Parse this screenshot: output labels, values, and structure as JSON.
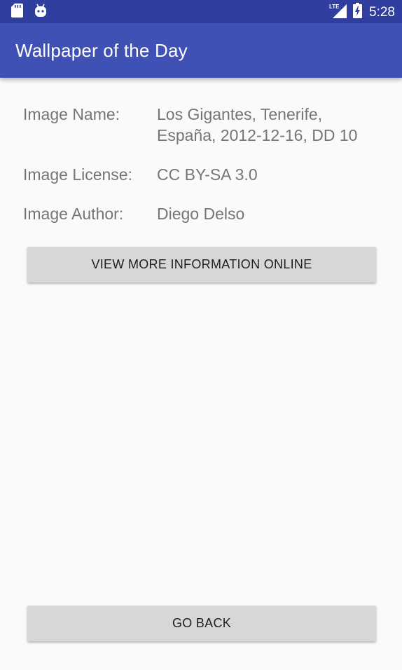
{
  "status_bar": {
    "time": "5:28",
    "network": "LTE",
    "icons": [
      "sd-card-icon",
      "android-icon",
      "lte-signal-icon",
      "battery-charging-icon"
    ],
    "background": "#303f9f"
  },
  "app_bar": {
    "title": "Wallpaper of the Day",
    "background": "#3f51b5"
  },
  "details": [
    {
      "label": "Image Name:",
      "value": "Los Gigantes, Tenerife, España, 2012-12-16, DD 10"
    },
    {
      "label": "Image License:",
      "value": "CC BY-SA 3.0"
    },
    {
      "label": "Image Author:",
      "value": "Diego Delso"
    }
  ],
  "buttons": {
    "view_more": "VIEW MORE INFORMATION ONLINE",
    "go_back": "GO BACK"
  }
}
